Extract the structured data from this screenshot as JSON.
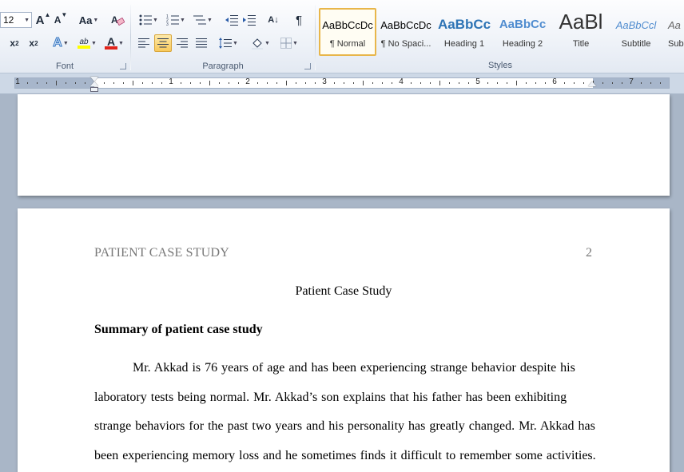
{
  "ribbon": {
    "font": {
      "label": "Font",
      "size_value": "12",
      "grow_font": "A",
      "shrink_font": "A",
      "change_case": "Aa",
      "subscript": "x",
      "subscript_sub": "2",
      "superscript": "x",
      "superscript_sup": "2",
      "text_effects": "A",
      "highlight": "ab",
      "font_color": "A"
    },
    "paragraph": {
      "label": "Paragraph",
      "show_marks": "¶",
      "sort": "A↓"
    },
    "styles": {
      "label": "Styles",
      "items": [
        {
          "preview": "AaBbCcDc",
          "name": "¶ Normal"
        },
        {
          "preview": "AaBbCcDc",
          "name": "¶ No Spaci..."
        },
        {
          "preview": "AaBbCc",
          "name": "Heading 1"
        },
        {
          "preview": "AaBbCc",
          "name": "Heading 2"
        },
        {
          "preview": "AaBl",
          "name": "Title"
        },
        {
          "preview": "AaBbCcl",
          "name": "Subtitle"
        },
        {
          "preview": "Aa",
          "name": "Sub"
        }
      ]
    }
  },
  "ruler": {
    "numbers": [
      "1",
      "1",
      "2",
      "3",
      "4",
      "5",
      "6",
      "7"
    ]
  },
  "document": {
    "running_head": "PATIENT CASE STUDY",
    "page_number": "2",
    "title": "Patient Case Study",
    "heading": "Summary of patient case study",
    "paragraph_lines": [
      "Mr. Akkad is 76 years of age and has been experiencing strange behavior despite his",
      "laboratory tests being normal. Mr. Akkad’s son explains that his father has been exhibiting",
      "strange behaviors for the past two years and his personality has greatly changed. Mr. Akkad has",
      "been experiencing memory loss and he sometimes finds it difficult to remember some activities."
    ]
  },
  "colors": {
    "selected_style_border": "#e8b64a",
    "heading_blue": "#2e74b5",
    "highlight_yellow": "#ffff00",
    "font_color_red": "#e0241b"
  }
}
